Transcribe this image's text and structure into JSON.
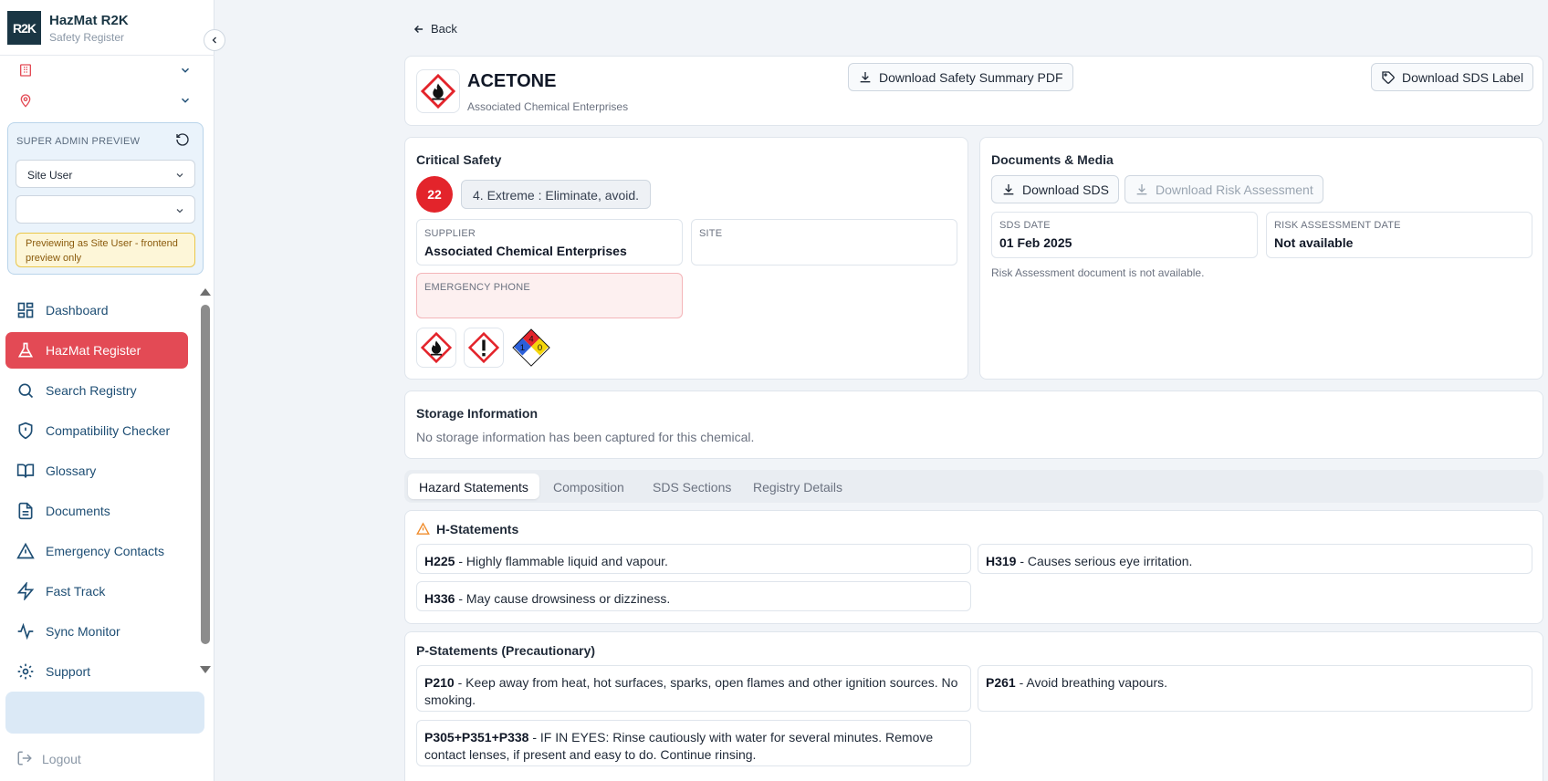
{
  "app": {
    "logo_text": "R2K",
    "title": "HazMat R2K",
    "subtitle": "Safety Register"
  },
  "preview": {
    "label": "SUPER ADMIN PREVIEW",
    "role_select": "Site User",
    "site_select": "",
    "notice": "Previewing as Site User - frontend preview only"
  },
  "nav": {
    "dashboard": "Dashboard",
    "hazmat_register": "HazMat Register",
    "search_registry": "Search Registry",
    "compatibility_checker": "Compatibility Checker",
    "glossary": "Glossary",
    "documents": "Documents",
    "emergency_contacts": "Emergency Contacts",
    "fast_track": "Fast Track",
    "sync_monitor": "Sync Monitor",
    "support": "Support",
    "logout": "Logout"
  },
  "colors": {
    "accent_red": "#e34a55",
    "nav_text": "#1e4e74",
    "brand_dark": "#1a3644",
    "risk_red": "#e3242b"
  },
  "page": {
    "back": "Back",
    "chemical_name": "ACETONE",
    "manufacturer": "Associated Chemical Enterprises",
    "download_summary": "Download Safety Summary PDF",
    "download_label": "Download SDS Label"
  },
  "critical": {
    "title": "Critical Safety",
    "risk_score": "22",
    "risk_level": "4. Extreme : Eliminate, avoid.",
    "supplier_label": "SUPPLIER",
    "supplier_value": "Associated Chemical Enterprises",
    "site_label": "SITE",
    "site_value": "",
    "emergency_label": "EMERGENCY PHONE",
    "emergency_value": "",
    "nfpa": {
      "health": "1",
      "flammability": "4",
      "instability": "0"
    },
    "pictograms": [
      "flame-pictogram",
      "exclamation-pictogram",
      "nfpa-diamond"
    ]
  },
  "documents": {
    "title": "Documents & Media",
    "download_sds": "Download SDS",
    "download_risk": "Download Risk Assessment",
    "sds_date_label": "SDS DATE",
    "sds_date_value": "01 Feb 2025",
    "risk_date_label": "RISK ASSESSMENT DATE",
    "risk_date_value": "Not available",
    "note": "Risk Assessment document is not available."
  },
  "storage": {
    "title": "Storage Information",
    "text": "No storage information has been captured for this chemical."
  },
  "tabs": {
    "hazard": "Hazard Statements",
    "composition": "Composition",
    "sds_sections": "SDS Sections",
    "registry_details": "Registry Details"
  },
  "h_statements": {
    "title": "H-Statements",
    "items": [
      {
        "code": "H225",
        "text": " - Highly flammable liquid and vapour."
      },
      {
        "code": "H319",
        "text": " - Causes serious eye irritation."
      },
      {
        "code": "H336",
        "text": " - May cause drowsiness or dizziness."
      }
    ]
  },
  "p_statements": {
    "title": "P-Statements (Precautionary)",
    "items": [
      {
        "code": "P210",
        "text": " - Keep away from heat, hot surfaces, sparks, open flames and other ignition sources. No smoking."
      },
      {
        "code": "P261",
        "text": " - Avoid breathing vapours."
      },
      {
        "code": "P305+P351+P338",
        "text": " - IF IN EYES: Rinse cautiously with water for several minutes. Remove contact lenses, if present and easy to do. Continue rinsing."
      }
    ]
  }
}
